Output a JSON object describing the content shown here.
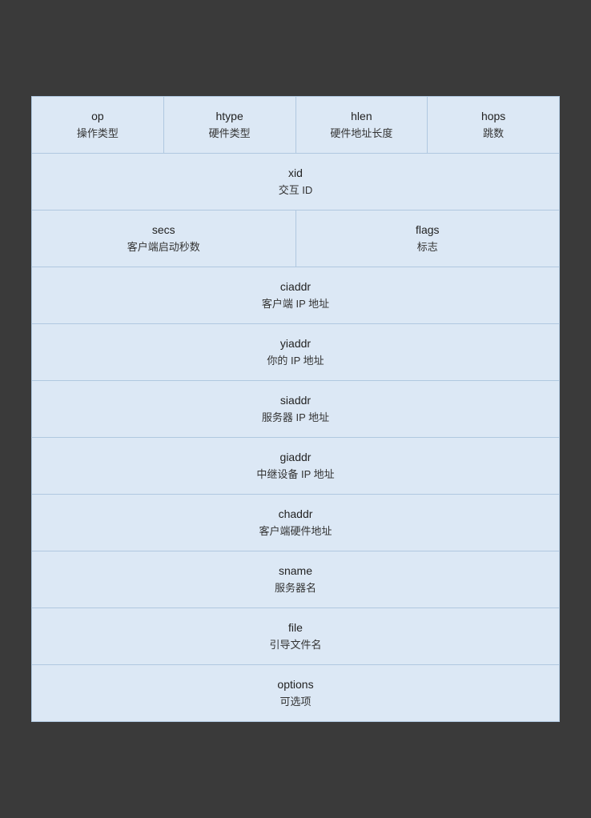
{
  "diagram": {
    "rows": [
      {
        "type": "four-col",
        "cells": [
          {
            "name": "op",
            "desc": "操作类型"
          },
          {
            "name": "htype",
            "desc": "硬件类型"
          },
          {
            "name": "hlen",
            "desc": "硬件地址长度"
          },
          {
            "name": "hops",
            "desc": "跳数"
          }
        ]
      },
      {
        "type": "full",
        "cells": [
          {
            "name": "xid",
            "desc": "交互 ID"
          }
        ]
      },
      {
        "type": "two-col",
        "cells": [
          {
            "name": "secs",
            "desc": "客户端启动秒数"
          },
          {
            "name": "flags",
            "desc": "标志"
          }
        ]
      },
      {
        "type": "full",
        "cells": [
          {
            "name": "ciaddr",
            "desc": "客户端 IP 地址"
          }
        ]
      },
      {
        "type": "full",
        "cells": [
          {
            "name": "yiaddr",
            "desc": "你的 IP 地址"
          }
        ]
      },
      {
        "type": "full",
        "cells": [
          {
            "name": "siaddr",
            "desc": "服务器 IP 地址"
          }
        ]
      },
      {
        "type": "full",
        "cells": [
          {
            "name": "giaddr",
            "desc": "中继设备 IP 地址"
          }
        ]
      },
      {
        "type": "full",
        "cells": [
          {
            "name": "chaddr",
            "desc": "客户端硬件地址"
          }
        ]
      },
      {
        "type": "full",
        "cells": [
          {
            "name": "sname",
            "desc": "服务器名"
          }
        ]
      },
      {
        "type": "full",
        "cells": [
          {
            "name": "file",
            "desc": "引导文件名"
          }
        ]
      },
      {
        "type": "full",
        "cells": [
          {
            "name": "options",
            "desc": "可选项"
          }
        ]
      }
    ]
  }
}
